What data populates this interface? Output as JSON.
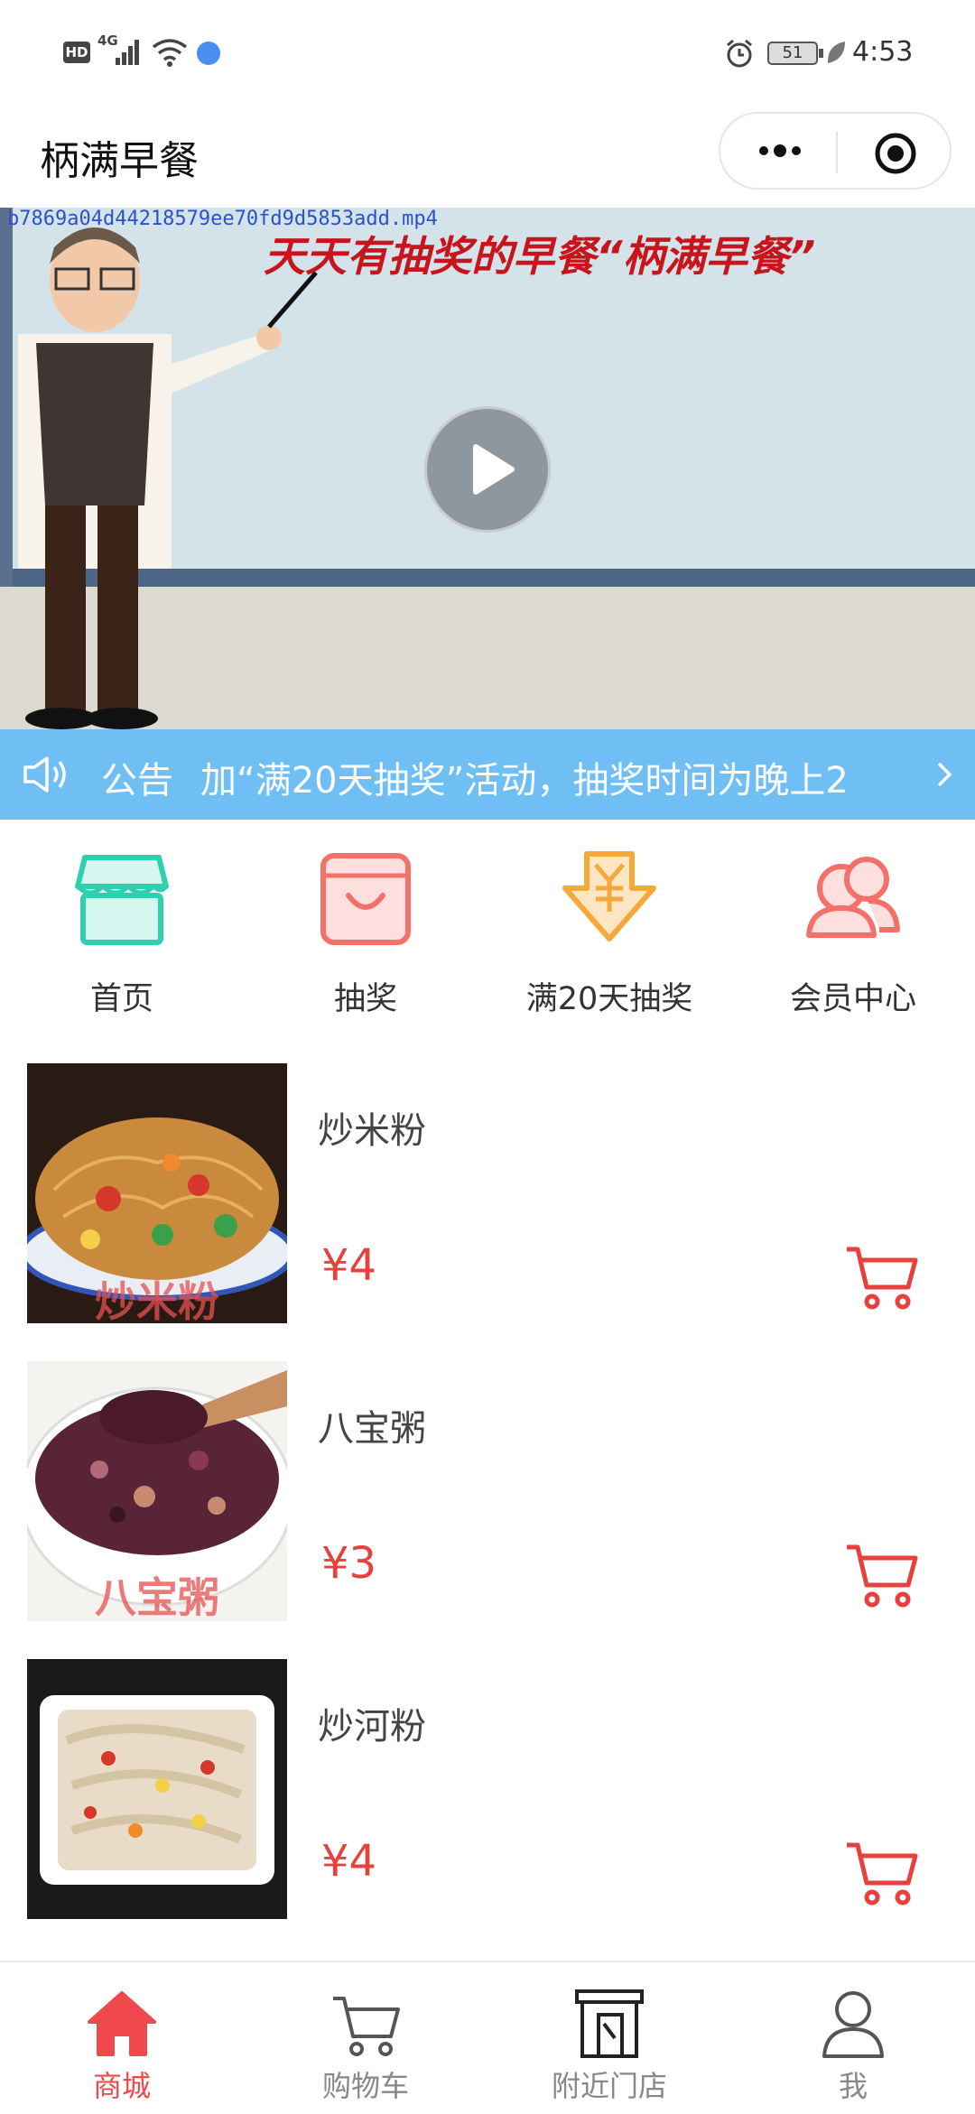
{
  "status_bar": {
    "left_icons": [
      "hd-icon",
      "4g-signal-icon",
      "wifi-icon",
      "vpn-icon"
    ],
    "hd": "HD",
    "network": "4G",
    "battery": "51",
    "time": "4:53"
  },
  "title_bar": {
    "title": "柄满早餐",
    "more_icon": "more-dots-icon",
    "close_icon": "target-close-icon"
  },
  "video": {
    "filename": "b7869a04d44218579ee70fd9d5853add.mp4",
    "headline": "天天有抽奖的早餐“柄满早餐”"
  },
  "notice": {
    "label": "公告",
    "text": "加“满20天抽奖”活动，抽奖时间为晚上2",
    "icon": "speaker-icon"
  },
  "quick_nav": [
    {
      "label": "首页",
      "icon": "shop-icon",
      "color": "#2fd0b0"
    },
    {
      "label": "抽奖",
      "icon": "gift-bag-icon",
      "color": "#f4706a"
    },
    {
      "label": "满20天抽奖",
      "icon": "yuan-download-icon",
      "color": "#f5a93a"
    },
    {
      "label": "会员中心",
      "icon": "members-icon",
      "color": "#f4706a"
    }
  ],
  "products": [
    {
      "name": "炒米粉",
      "price": "¥4",
      "caption": "炒米粉"
    },
    {
      "name": "八宝粥",
      "price": "¥3",
      "caption": "八宝粥"
    },
    {
      "name": "炒河粉",
      "price": "¥4",
      "caption": ""
    }
  ],
  "tab_bar": [
    {
      "label": "商城",
      "icon": "home-icon",
      "active": true
    },
    {
      "label": "购物车",
      "icon": "cart-icon",
      "active": false
    },
    {
      "label": "附近门店",
      "icon": "store-icon",
      "active": false
    },
    {
      "label": "我",
      "icon": "user-icon",
      "active": false
    }
  ],
  "colors": {
    "accent": "#f0494d",
    "price": "#e8403c",
    "notice_bg": "#6fbff5"
  }
}
